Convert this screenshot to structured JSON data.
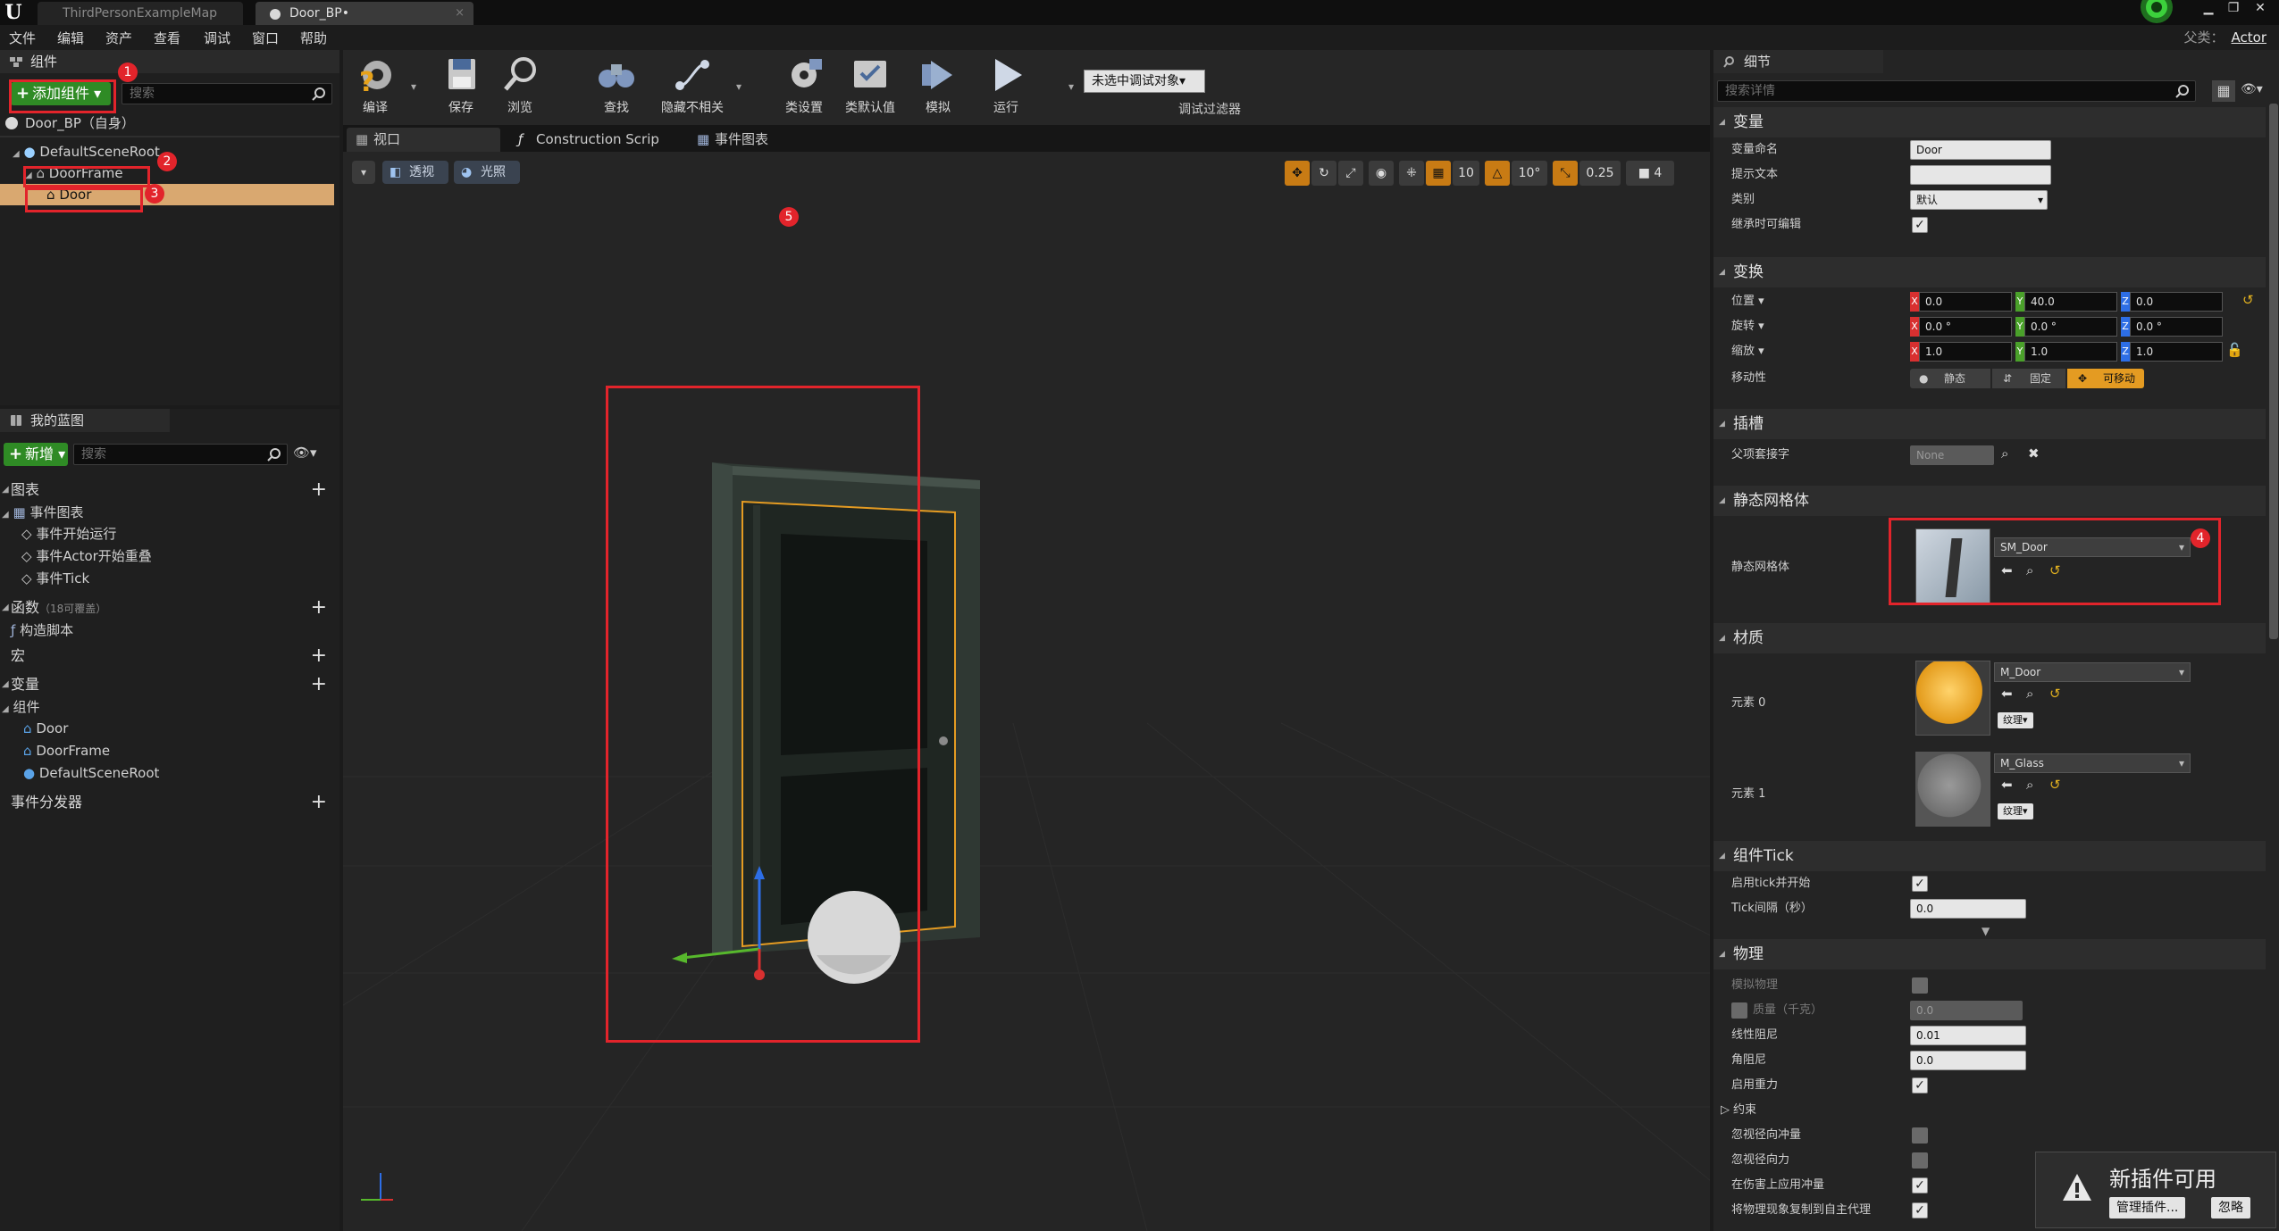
{
  "window": {
    "tabs": [
      {
        "label": "ThirdPersonExampleMap"
      },
      {
        "label": "Door_BP•"
      }
    ],
    "parent_class_label": "父类：",
    "parent_class_value": "Actor"
  },
  "menu": [
    "文件",
    "编辑",
    "资产",
    "查看",
    "调试",
    "窗口",
    "帮助"
  ],
  "components_panel": {
    "title": "组件",
    "add_button": "添加组件",
    "search_placeholder": "搜索",
    "self_item": "Door_BP（自身）",
    "tree": [
      {
        "label": "DefaultSceneRoot"
      },
      {
        "label": "DoorFrame"
      },
      {
        "label": "Door"
      }
    ]
  },
  "my_blueprint": {
    "title": "我的蓝图",
    "new_button": "新增",
    "search_placeholder": "搜索",
    "graphs_label": "图表",
    "event_graph_label": "事件图表",
    "events": [
      "事件开始运行",
      "事件Actor开始重叠",
      "事件Tick"
    ],
    "functions_label": "函数",
    "functions_note": "（18可覆盖）",
    "construction_script": "构造脚本",
    "macros_label": "宏",
    "variables_label": "变量",
    "components_group_label": "组件",
    "variables": [
      "Door",
      "DoorFrame",
      "DefaultSceneRoot"
    ],
    "event_dispatchers_label": "事件分发器"
  },
  "toolbar": {
    "compile": "编译",
    "save": "保存",
    "browse": "浏览",
    "find": "查找",
    "hide_unrelated": "隐藏不相关",
    "class_settings": "类设置",
    "class_defaults": "类默认值",
    "simulate": "模拟",
    "play": "运行",
    "debug_object": "未选中调试对象▾",
    "debug_filter": "调试过滤器"
  },
  "doc_tabs": [
    "视口",
    "Construction Scrip",
    "事件图表"
  ],
  "viewport": {
    "perspective": "透视",
    "lit": "光照",
    "grid_snap": "10",
    "rotation_snap": "10°",
    "scale_snap": "0.25",
    "camera_speed": "4"
  },
  "annotations": [
    "1",
    "2",
    "3",
    "4",
    "5"
  ],
  "details": {
    "title": "细节",
    "search_placeholder": "搜索详情",
    "variable": {
      "header": "变量",
      "name_label": "变量命名",
      "name_value": "Door",
      "tooltip_label": "提示文本",
      "tooltip_value": "",
      "category_label": "类别",
      "category_value": "默认",
      "editable_label": "继承时可编辑"
    },
    "transform": {
      "header": "变换",
      "location_label": "位置 ▾",
      "location": [
        "0.0",
        "40.0",
        "0.0"
      ],
      "rotation_label": "旋转 ▾",
      "rotation": [
        "0.0 °",
        "0.0 °",
        "0.0 °"
      ],
      "scale_label": "缩放 ▾",
      "scale": [
        "1.0",
        "1.0",
        "1.0"
      ],
      "mobility_label": "移动性",
      "mobility_options": [
        "静态",
        "固定",
        "可移动"
      ]
    },
    "sockets": {
      "header": "插槽",
      "parent_socket_label": "父项套接字",
      "parent_socket_value": "None"
    },
    "static_mesh": {
      "header": "静态网格体",
      "label": "静态网格体",
      "value": "SM_Door"
    },
    "materials": {
      "header": "材质",
      "items": [
        {
          "label": "元素 0",
          "value": "M_Door",
          "texture": "纹理▾"
        },
        {
          "label": "元素 1",
          "value": "M_Glass",
          "texture": "纹理▾"
        }
      ]
    },
    "component_tick": {
      "header": "组件Tick",
      "start_label": "启用tick并开始",
      "interval_label": "Tick间隔（秒）",
      "interval_value": "0.0"
    },
    "physics": {
      "header": "物理",
      "simulate_label": "模拟物理",
      "mass_label": "质量（千克）",
      "mass_value": "0.0",
      "linear_damping_label": "线性阻尼",
      "linear_damping_value": "0.01",
      "angular_damping_label": "角阻尼",
      "angular_damping_value": "0.0",
      "gravity_label": "启用重力",
      "constraints_label": "约束",
      "ignore_radial_impulse_label": "忽视径向冲量",
      "ignore_radial_force_label": "忽视径向力",
      "apply_impulse_label": "在伤害上应用冲量",
      "replicate_physics_label": "将物理现象复制到自主代理"
    }
  },
  "notification": {
    "title": "新插件可用",
    "manage_button": "管理插件...",
    "dismiss_button": "忽略"
  },
  "colors": {
    "accent_red": "#e2242b",
    "selection": "#d9a870",
    "add_green": "#2f8b25",
    "orange": "#c87b14"
  }
}
